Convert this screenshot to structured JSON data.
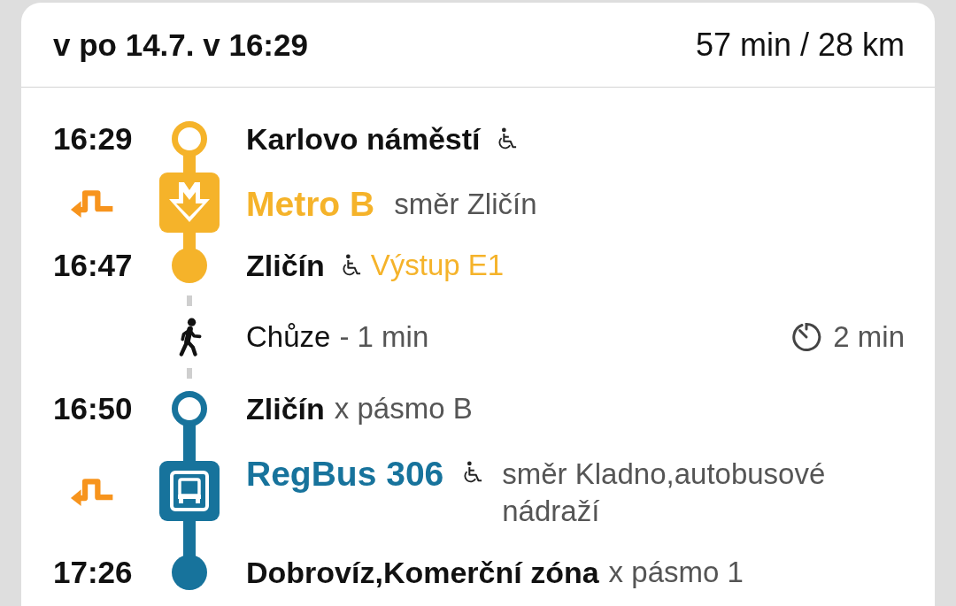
{
  "header": {
    "departure": "v po 14.7. v 16:29",
    "summary": "57 min / 28 km"
  },
  "legs": [
    {
      "kind": "metro",
      "color": "#f5b32a",
      "from": {
        "time": "16:29",
        "stop": "Karlovo náměstí",
        "accessible": true
      },
      "line": "Metro B",
      "direction": "směr Zličín",
      "to": {
        "time": "16:47",
        "stop": "Zličín",
        "accessible": true,
        "exit": "Výstup E1"
      }
    },
    {
      "kind": "walk",
      "label": "Chůze",
      "duration": "- 1 min",
      "wait": "2 min"
    },
    {
      "kind": "bus",
      "color": "#17739c",
      "from": {
        "time": "16:50",
        "stop": "Zličín",
        "zone": "x pásmo B"
      },
      "line": "RegBus 306",
      "accessible": true,
      "direction": "směr Kladno,autobusové nádraží",
      "to": {
        "time": "17:26",
        "stop": "Dobrovíz,Komerční zóna",
        "zone": "x pásmo 1"
      }
    }
  ]
}
